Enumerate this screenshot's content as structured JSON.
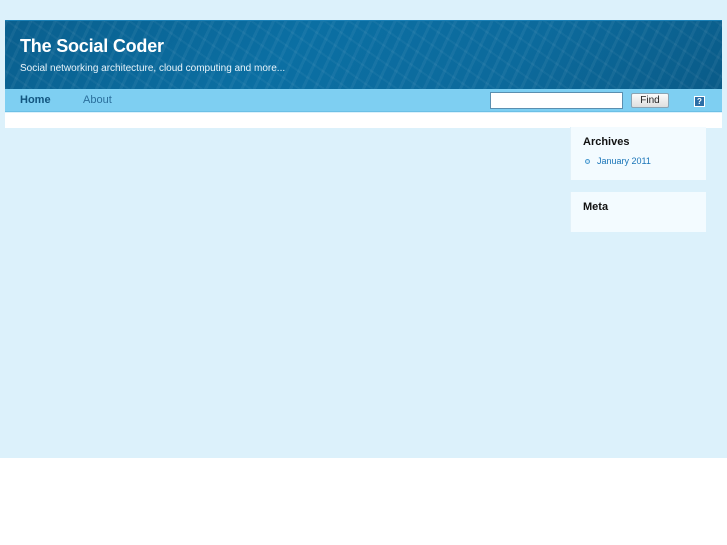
{
  "header": {
    "title": "The Social Coder",
    "tagline": "Social networking architecture, cloud computing and more..."
  },
  "nav": {
    "items": [
      {
        "label": "Home"
      },
      {
        "label": "About"
      }
    ],
    "search": {
      "value": "",
      "placeholder": ""
    },
    "find_label": "Find",
    "help_icon": "?"
  },
  "sidebar": {
    "archives": {
      "title": "Archives",
      "links": [
        {
          "label": "January 2011"
        }
      ]
    },
    "meta": {
      "title": "Meta"
    }
  },
  "colors": {
    "header_bg": "#0b6fa3",
    "nav_bg": "#7ecff2",
    "page_bg": "#dcf1fb",
    "link": "#1a75b8"
  }
}
